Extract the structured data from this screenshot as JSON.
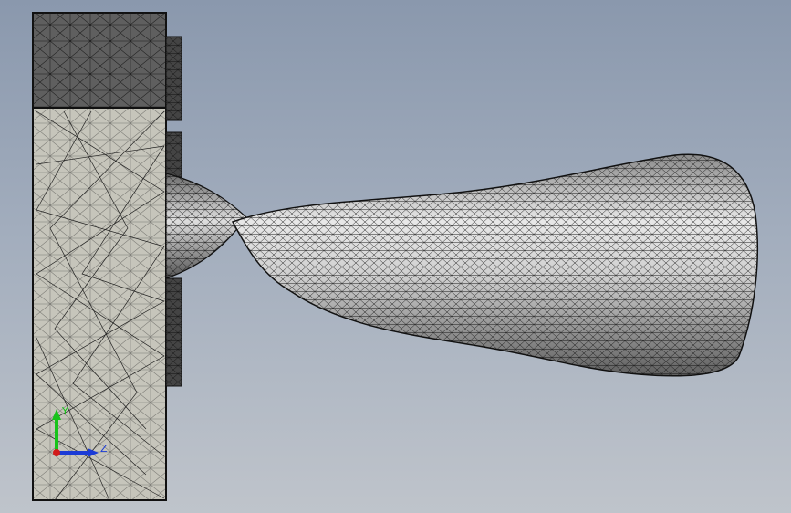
{
  "viewport": {
    "background_top": "#8a98ad",
    "background_bottom": "#bfc4cb",
    "mesh_color": "#1a1a1a",
    "surface_light": "#c6c5bb",
    "surface_dark": "#5d5d5d",
    "part_light": "#f2f2f2"
  },
  "model": {
    "type": "meshed-3d-model",
    "parts": [
      "mold-block",
      "bulb-body",
      "neck"
    ]
  },
  "triad": {
    "x_label": "",
    "y_label": "Y",
    "z_label": "Z",
    "y_color": "#17c31a",
    "z_color": "#1b3bd6",
    "x_color": "#d21a1a"
  }
}
